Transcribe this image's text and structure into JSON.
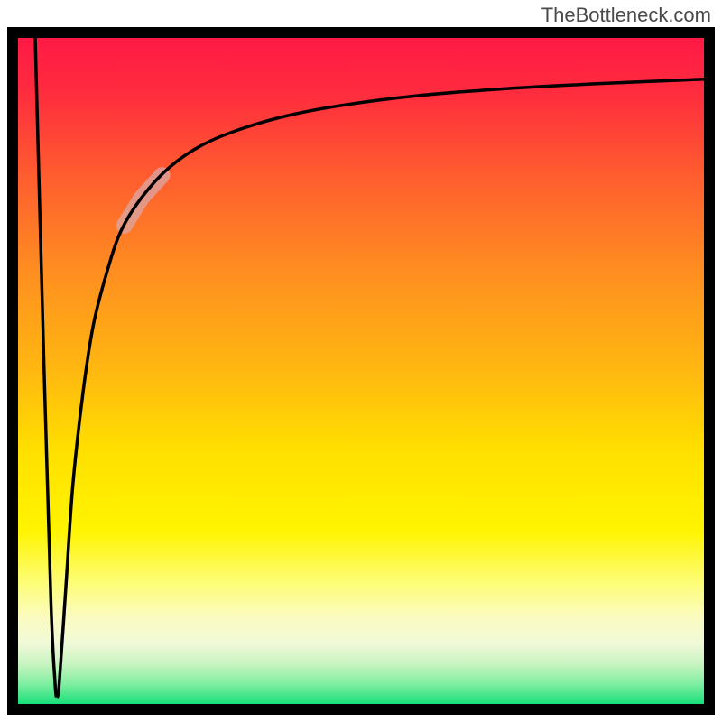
{
  "watermark": "TheBottleneck.com",
  "chart_data": {
    "type": "line",
    "title": "",
    "xlabel": "",
    "ylabel": "",
    "xlim": [
      0,
      100
    ],
    "ylim": [
      0,
      100
    ],
    "background_gradient": {
      "stops": [
        {
          "offset": 0.0,
          "color": "#ff1a45"
        },
        {
          "offset": 0.08,
          "color": "#ff2b3e"
        },
        {
          "offset": 0.2,
          "color": "#ff5a30"
        },
        {
          "offset": 0.35,
          "color": "#ff8e20"
        },
        {
          "offset": 0.5,
          "color": "#ffb810"
        },
        {
          "offset": 0.62,
          "color": "#ffe000"
        },
        {
          "offset": 0.74,
          "color": "#fff400"
        },
        {
          "offset": 0.82,
          "color": "#fdfd7a"
        },
        {
          "offset": 0.87,
          "color": "#fbfbc0"
        },
        {
          "offset": 0.91,
          "color": "#f0f9d8"
        },
        {
          "offset": 0.94,
          "color": "#c8f4c0"
        },
        {
          "offset": 0.97,
          "color": "#80eea0"
        },
        {
          "offset": 1.0,
          "color": "#18e07a"
        }
      ]
    },
    "series": [
      {
        "name": "left-spike",
        "type": "line",
        "x": [
          2.5,
          3.8,
          4.8,
          5.4,
          5.6
        ],
        "y": [
          100,
          50,
          15,
          3,
          1
        ]
      },
      {
        "name": "main-curve",
        "type": "line",
        "x": [
          5.6,
          6.0,
          7.0,
          8.0,
          9.5,
          11,
          13,
          15,
          18,
          22,
          27,
          33,
          40,
          48,
          58,
          70,
          84,
          100
        ],
        "y": [
          1,
          3,
          18,
          33,
          47,
          57,
          65,
          71,
          76,
          80.5,
          84,
          86.5,
          88.5,
          90,
          91.3,
          92.3,
          93.1,
          93.8
        ]
      }
    ],
    "highlight_segment": {
      "on_series": "main-curve",
      "x_range": [
        15.5,
        21.0
      ],
      "color": "#d9a7a7",
      "opacity": 0.75,
      "width": 18
    },
    "axes": {
      "border_width": 12,
      "border_color": "#000000",
      "show_ticks": false,
      "show_grid": false
    }
  }
}
